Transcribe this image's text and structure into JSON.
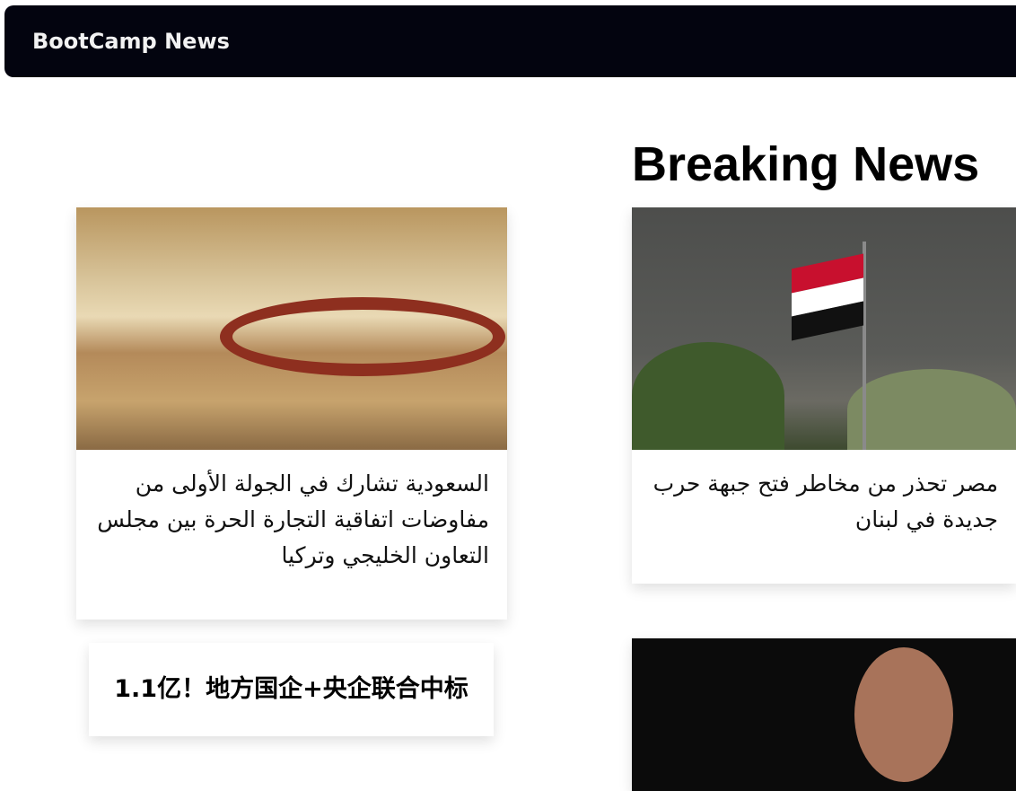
{
  "navbar": {
    "brand": "BootCamp News"
  },
  "page": {
    "heading": "Breaking News"
  },
  "articles": [
    {
      "title": "السعودية تشارك في الجولة الأولى من مفاوضات اتفاقية التجارة الحرة بين مجلس التعاون الخليجي وتركيا",
      "image": "gcc-summit-photo"
    },
    {
      "title": "مصر تحذر من مخاطر فتح جبهة حرب جديدة في لبنان",
      "image": "egypt-flag-photo"
    },
    {
      "title": "1.1亿！地方国企+央企联合中标"
    },
    {
      "title": "",
      "image": "man-pointing-photo"
    }
  ]
}
